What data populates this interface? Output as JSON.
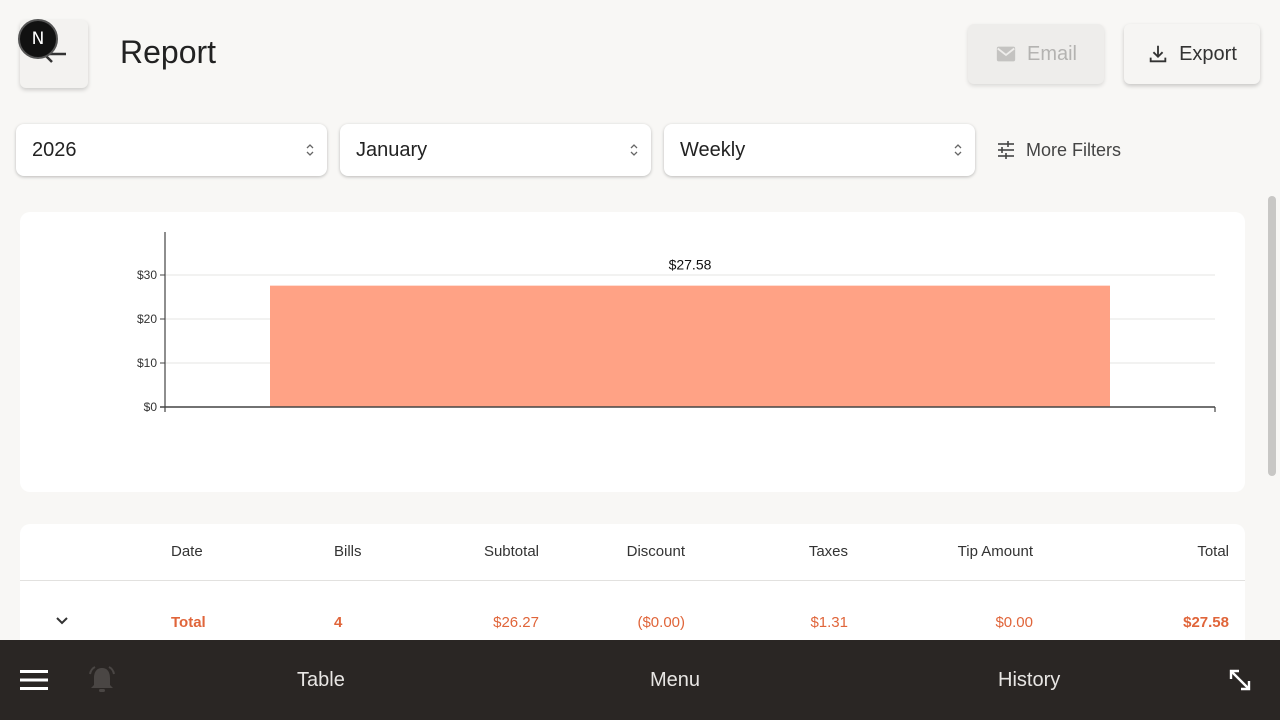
{
  "header": {
    "title": "Report",
    "badge": "N",
    "email_label": "Email",
    "export_label": "Export"
  },
  "filters": {
    "year": "2026",
    "month": "January",
    "period": "Weekly",
    "more_filters_label": "More Filters"
  },
  "chart_data": {
    "type": "bar",
    "categories": [
      ""
    ],
    "values": [
      27.58
    ],
    "value_labels": [
      "$27.58"
    ],
    "yticks": [
      "$0",
      "$10",
      "$20",
      "$30"
    ],
    "ylim": [
      0,
      40
    ],
    "grid": true,
    "bar_color": "#ffa285"
  },
  "table": {
    "columns": [
      "Date",
      "Bills",
      "Subtotal",
      "Discount",
      "Taxes",
      "Tip Amount",
      "Total"
    ],
    "rows": [
      {
        "date": "Total",
        "bills": "4",
        "subtotal": "$26.27",
        "discount": "($0.00)",
        "taxes": "$1.31",
        "tip": "$0.00",
        "total": "$27.58"
      }
    ]
  },
  "bottom_nav": {
    "items": [
      "Table",
      "Menu",
      "History"
    ]
  },
  "colors": {
    "accent": "#e0653a",
    "bar": "#ffa285",
    "bottom_bar": "#2a2624",
    "background": "#f8f7f5"
  },
  "icons": {
    "back": "arrow-left-icon",
    "email": "mail-icon",
    "export": "download-icon",
    "filters": "sliders-icon",
    "menu": "hamburger-icon",
    "bell": "bell-icon",
    "fullscreen": "expand-arrows-icon"
  }
}
